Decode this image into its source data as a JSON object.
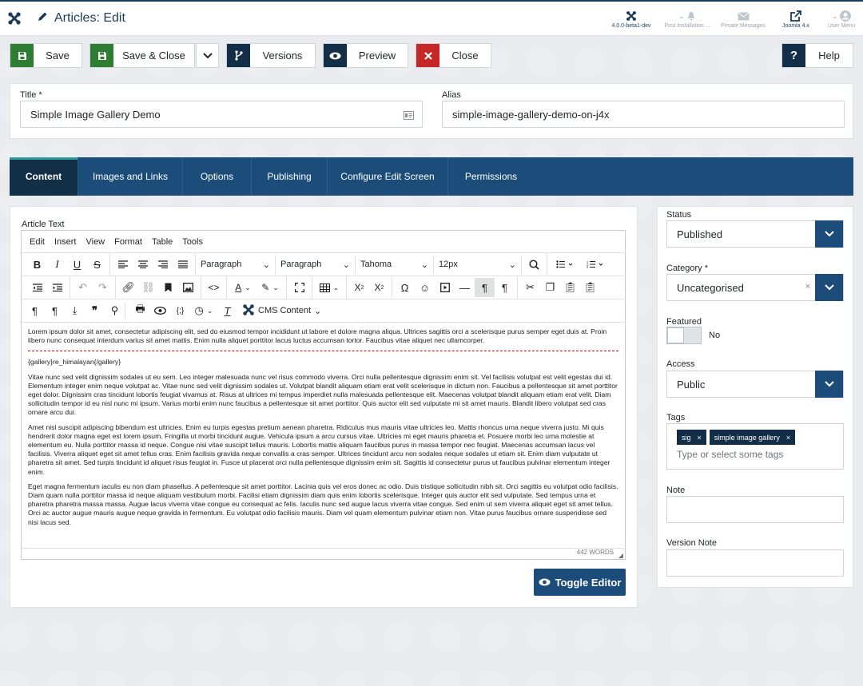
{
  "header": {
    "title": "Articles: Edit",
    "items": [
      {
        "label": "4.0.0-beta1-dev",
        "icon": "joomla-icon"
      },
      {
        "label": "Post Installation ...",
        "icon": "bell-icon"
      },
      {
        "label": "Private Messages",
        "icon": "envelope-icon"
      },
      {
        "label": "Joomla 4.x",
        "icon": "external-link-icon"
      },
      {
        "label": "User Menu",
        "icon": "user-icon"
      }
    ]
  },
  "toolbar": {
    "save": "Save",
    "save_close": "Save & Close",
    "versions": "Versions",
    "preview": "Preview",
    "close": "Close",
    "help": "Help",
    "colors": {
      "save": "#2f7d32",
      "dark": "#132f48",
      "close": "#c52827"
    }
  },
  "form": {
    "title_label": "Title *",
    "title_value": "Simple Image Gallery Demo",
    "alias_label": "Alias",
    "alias_value": "simple-image-gallery-demo-on-j4x"
  },
  "tabs": [
    "Content",
    "Images and Links",
    "Options",
    "Publishing",
    "Configure Edit Screen",
    "Permissions"
  ],
  "editor": {
    "label": "Article Text",
    "menu": [
      "Edit",
      "Insert",
      "View",
      "Format",
      "Table",
      "Tools"
    ],
    "format1": "Paragraph",
    "format2": "Paragraph",
    "font": "Tahoma",
    "size": "12px",
    "cms_content": "CMS Content",
    "p1": "Lorem ipsum dolor sit amet, consectetur adipiscing elit, sed do eiusmod tempor incididunt ut labore et dolore magna aliqua. Ultrices sagittis orci a scelerisque purus semper eget duis at. Proin libero nunc consequat interdum varius sit amet mattis. Enim nulla aliquet porttitor lacus luctus accumsan tortor. Faucibus vitae aliquet nec ullamcorper.",
    "p2": "{gallery}re_himalayan{/gallery}",
    "p3": "Vitae nunc sed velit dignissim sodales ut eu sem. Leo integer malesuada nunc vel risus commodo viverra. Orci nulla pellentesque dignissim enim sit. Vel facilisis volutpat est velit egestas dui id. Elementum integer enim neque volutpat ac. Vitae nunc sed velit dignissim sodales ut. Volutpat blandit aliquam etiam erat velit scelerisque in dictum non. Faucibus a pellentesque sit amet porttitor eget dolor. Dignissim cras tincidunt lobortis feugiat vivamus at. Risus at ultrices mi tempus imperdiet nulla malesuada pellentesque elit. Maecenas volutpat blandit aliquam etiam erat velit. Diam sollicitudin tempor id eu nisl nunc mi ipsum. Varius morbi enim nunc faucibus a pellentesque sit amet porttitor. Quis auctor elit sed vulputate mi sit amet mauris. Blandit libero volutpat sed cras ornare arcu dui.",
    "p4": "Amet nisl suscipit adipiscing bibendum est ultricies. Enim eu turpis egestas pretium aenean pharetra. Ridiculus mus mauris vitae ultricies leo. Mattis rhoncus urna neque viverra justo. Mi quis hendrerit dolor magna eget est lorem ipsum. Fringilla ut morbi tincidunt augue. Vehicula ipsum a arcu cursus vitae. Ultricies mi eget mauris pharetra et. Posuere morbi leo urna molestie at elementum eu. Nulla porttitor massa id neque. Congue nisi vitae suscipit tellus mauris. Lobortis mattis aliquam faucibus purus in massa tempor nec feugiat. Maecenas accumsan lacus vel facilisis. Viverra aliquet eget sit amet tellus cras. Enim facilisis gravida neque convallis a cras semper. Ultrices tincidunt arcu non sodales neque sodales ut etiam sit. Enim diam vulputate ut pharetra sit amet. Sed turpis tincidunt id aliquet risus feugiat in. Fusce ut placerat orci nulla pellentesque dignissim enim sit. Sagittis id consectetur purus ut faucibus pulvinar elementum integer enim.",
    "p5": "Eget magna fermentum iaculis eu non diam phasellus. A pellentesque sit amet porttitor. Lacinia quis vel eros donec ac odio. Duis tristique sollicitudin nibh sit. Orci sagittis eu volutpat odio facilisis. Diam quam nulla porttitor massa id neque aliquam vestibulum morbi. Facilisi etiam dignissim diam quis enim lobortis scelerisque. Integer quis auctor elit sed vulputate. Sed tempus urna et pharetra pharetra massa massa. Augue lacus viverra vitae congue eu consequat ac felis. Iaculis nunc sed augue lacus viverra vitae congue. Sed enim ut sem viverra aliquet eget sit amet tellus. Orci ac auctor augue mauris augue neque gravida in fermentum. Eu volutpat odio facilisis mauris. Diam vel quam elementum pulvinar etiam non. Vitae purus faucibus ornare suspendisse sed nisi lacus sed.",
    "word_count": "442 WORDS",
    "toggle": "Toggle Editor"
  },
  "sidebar": {
    "status_label": "Status",
    "status_value": "Published",
    "category_label": "Category *",
    "category_value": "Uncategorised",
    "clear": "×",
    "featured_label": "Featured",
    "featured_value": "No",
    "access_label": "Access",
    "access_value": "Public",
    "tags_label": "Tags",
    "tags": [
      "sig",
      "simple image gallery"
    ],
    "tag_remove": "×",
    "tags_placeholder": "Type or select some tags",
    "note_label": "Note",
    "version_note_label": "Version Note"
  }
}
